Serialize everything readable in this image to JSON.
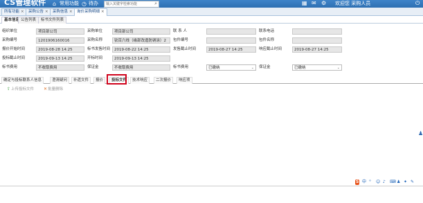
{
  "header": {
    "app_title": "CS管理软件",
    "nav": [
      {
        "icon": "home-icon",
        "glyph": "⌂",
        "label": "常用功能"
      },
      {
        "icon": "clock-icon",
        "glyph": "◷",
        "label": "待办"
      }
    ],
    "search_placeholder": "输入关键字检索功能",
    "user_text": "欢迎您 采购人员",
    "right_icons": [
      {
        "name": "grid-icon",
        "glyph": "▦"
      },
      {
        "name": "bell-icon",
        "glyph": "✉"
      },
      {
        "name": "settings-icon",
        "glyph": "⚙"
      },
      {
        "name": "power-icon",
        "glyph": "⏻"
      }
    ]
  },
  "main_tabs": [
    {
      "label": "所有功能",
      "active": false
    },
    {
      "label": "采购公告",
      "active": false
    },
    {
      "label": "采购信息",
      "active": false
    },
    {
      "label": "询价采购明细",
      "active": true
    }
  ],
  "sub_tabs": [
    {
      "label": "基本信息",
      "active": true
    },
    {
      "label": "公告列表",
      "active": false
    },
    {
      "label": "标书文件列表",
      "active": false
    }
  ],
  "form": {
    "row1": {
      "l1": "组织单位",
      "v1": "项目部公司",
      "l2": "采购单位",
      "v2": "项目部公司",
      "l3": "联 系 人",
      "v3": "",
      "l4": "联系电话",
      "v4": ""
    },
    "row2": {
      "l1": "采购编号",
      "v1": "1201906160016",
      "l2": "采购名称",
      "v2": "钦百六线（缘部改造防锈涂）2",
      "l3": "包件编号",
      "v3": "",
      "l4": "包件名称",
      "v4": ""
    },
    "row3": {
      "l1": "报价开始时间",
      "v1": "2019-08-28 14:25",
      "l2": "标书发售时间",
      "v2": "2019-08-22 14:25",
      "l3": "发售截止时间",
      "v3": "2019-08-27 14:25",
      "l4": "响应截止时间",
      "v4": "2019-08-27 14:25"
    },
    "row4": {
      "l1": "投标截止时间",
      "v1": "2019-09-13 14:25",
      "l2": "开标时间",
      "v2": "2019-09-13 14:25"
    },
    "row5": {
      "l1": "标书费用",
      "v1": "不收取费用",
      "l2": "保证金",
      "v2": "不收取费用",
      "l3": "标书费用",
      "v3": "已缴纳",
      "l4": "保证金",
      "v4": "已缴纳"
    }
  },
  "detail_tabs": [
    {
      "label": "确定与投标联系人信息",
      "active": false
    },
    {
      "label": "澄清疑问",
      "active": false
    },
    {
      "label": "补遗文件",
      "active": false
    },
    {
      "label": "报价",
      "active": false
    },
    {
      "label": "投标文件",
      "active": true
    },
    {
      "label": "技术响应",
      "active": false
    },
    {
      "label": "二次报价",
      "active": false
    },
    {
      "label": "响应项",
      "active": false
    }
  ],
  "toolbar": {
    "upload_label": "上传投标文件",
    "delete_label": "批量删除"
  },
  "bottom_icons": [
    {
      "name": "s-logo-icon",
      "glyph": "S"
    },
    {
      "name": "chinese-input-icon",
      "glyph": "中"
    },
    {
      "name": "punctuation-icon",
      "glyph": "°"
    },
    {
      "name": "emoji-icon",
      "glyph": "☺"
    },
    {
      "name": "microphone-icon",
      "glyph": "🎤"
    },
    {
      "name": "keyboard-icon",
      "glyph": "⌨"
    },
    {
      "name": "user-icon",
      "glyph": "♟"
    },
    {
      "name": "shirt-icon",
      "glyph": "✦"
    },
    {
      "name": "tools-icon",
      "glyph": "✎"
    }
  ],
  "colors": {
    "header": "#2d6fb2",
    "highlight": "#d0021b",
    "upload": "#3a9a3a",
    "delete": "#e07020"
  }
}
